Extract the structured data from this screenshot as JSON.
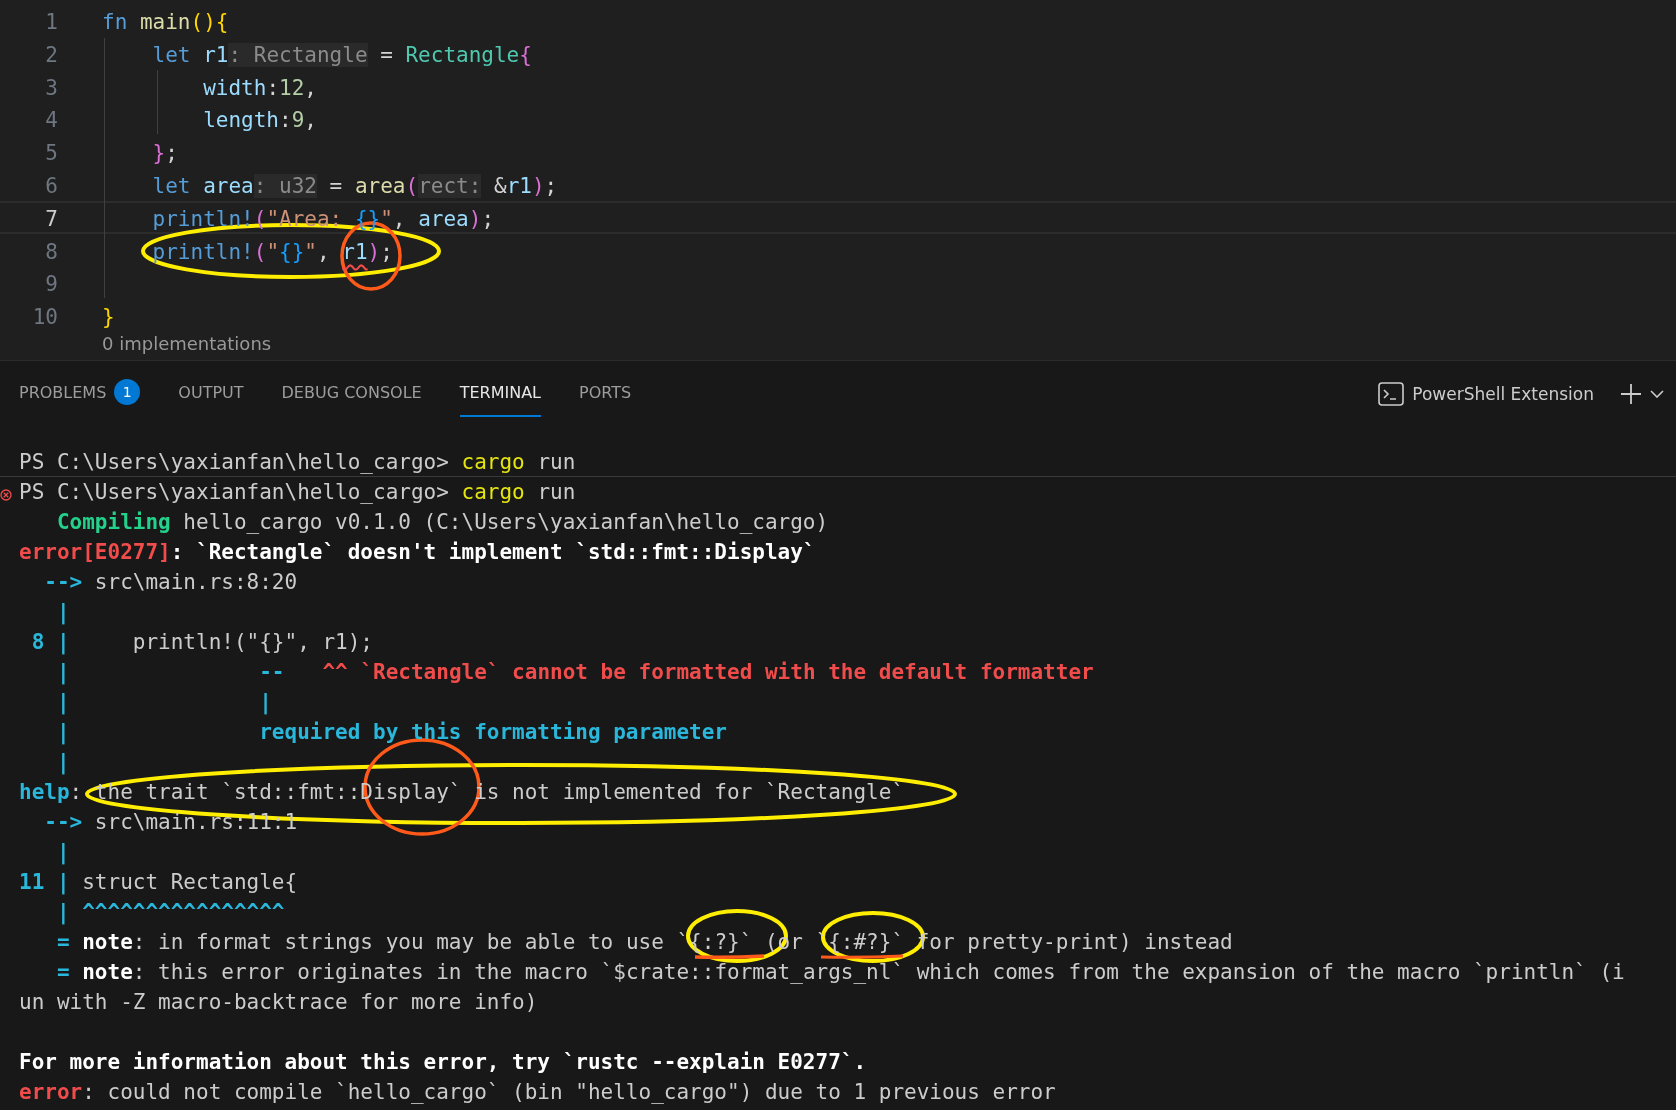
{
  "editor": {
    "lines": [
      {
        "number": "1",
        "current": false,
        "tokens": [
          {
            "text": "fn ",
            "kind": "kw"
          },
          {
            "text": "main",
            "kind": "fn"
          },
          {
            "text": "()",
            "kind": "brace1"
          },
          {
            "text": "{",
            "kind": "brace1"
          }
        ]
      },
      {
        "number": "2",
        "current": false,
        "tokens": [
          {
            "text": "    let ",
            "kind": "kw"
          },
          {
            "text": "r1",
            "kind": "var"
          },
          {
            "text": ": Rectangle",
            "kind": "hint"
          },
          {
            "text": " = ",
            "kind": "plain"
          },
          {
            "text": "Rectangle",
            "kind": "type"
          },
          {
            "text": "{",
            "kind": "brace2"
          }
        ]
      },
      {
        "number": "3",
        "current": false,
        "tokens": [
          {
            "text": "        width",
            "kind": "var"
          },
          {
            "text": ":",
            "kind": "plain"
          },
          {
            "text": "12",
            "kind": "num"
          },
          {
            "text": ",",
            "kind": "plain"
          }
        ]
      },
      {
        "number": "4",
        "current": false,
        "tokens": [
          {
            "text": "        length",
            "kind": "var"
          },
          {
            "text": ":",
            "kind": "plain"
          },
          {
            "text": "9",
            "kind": "num"
          },
          {
            "text": ",",
            "kind": "plain"
          }
        ]
      },
      {
        "number": "5",
        "current": false,
        "tokens": [
          {
            "text": "    }",
            "kind": "brace2"
          },
          {
            "text": ";",
            "kind": "plain"
          }
        ]
      },
      {
        "number": "6",
        "current": false,
        "tokens": [
          {
            "text": "    let ",
            "kind": "kw"
          },
          {
            "text": "area",
            "kind": "var"
          },
          {
            "text": ": u32",
            "kind": "hint"
          },
          {
            "text": " = ",
            "kind": "plain"
          },
          {
            "text": "area",
            "kind": "fn"
          },
          {
            "text": "(",
            "kind": "brace2"
          },
          {
            "text": "rect:",
            "kind": "hint"
          },
          {
            "text": " &",
            "kind": "plain"
          },
          {
            "text": "r1",
            "kind": "var"
          },
          {
            "text": ")",
            "kind": "brace2"
          },
          {
            "text": ";",
            "kind": "plain"
          }
        ]
      },
      {
        "number": "7",
        "current": true,
        "tokens": [
          {
            "text": "    println!",
            "kind": "kw"
          },
          {
            "text": "(",
            "kind": "brace2"
          },
          {
            "text": "\"Area: ",
            "kind": "str"
          },
          {
            "text": "{}",
            "kind": "brace3"
          },
          {
            "text": "\"",
            "kind": "str"
          },
          {
            "text": ", ",
            "kind": "plain"
          },
          {
            "text": "area",
            "kind": "var"
          },
          {
            "text": ")",
            "kind": "brace2"
          },
          {
            "text": ";",
            "kind": "plain"
          }
        ]
      },
      {
        "number": "8",
        "current": false,
        "tokens": [
          {
            "text": "    println!",
            "kind": "kw"
          },
          {
            "text": "(",
            "kind": "brace2"
          },
          {
            "text": "\"",
            "kind": "str"
          },
          {
            "text": "{}",
            "kind": "brace3"
          },
          {
            "text": "\"",
            "kind": "str"
          },
          {
            "text": ", ",
            "kind": "plain"
          },
          {
            "text": "r1",
            "kind": "error"
          },
          {
            "text": ")",
            "kind": "brace2"
          },
          {
            "text": ";",
            "kind": "plain"
          }
        ]
      },
      {
        "number": "9",
        "current": false
      },
      {
        "number": "10",
        "current": false,
        "tokens": [
          {
            "text": "}",
            "kind": "brace1"
          }
        ]
      }
    ],
    "codelens": "0 implementations"
  },
  "panel": {
    "tabs": [
      {
        "label": "PROBLEMS",
        "badge": "1",
        "selected": false
      },
      {
        "label": "OUTPUT",
        "selected": false
      },
      {
        "label": "DEBUG CONSOLE",
        "selected": false
      },
      {
        "label": "TERMINAL",
        "selected": true
      },
      {
        "label": "PORTS",
        "selected": false
      }
    ],
    "terminal_name": "PowerShell Extension"
  },
  "terminal": {
    "blocks": [
      [
        {
          "failed": false,
          "segments": [
            {
              "text": "PS C:\\Users\\yaxianfan\\hello_cargo> ",
              "kind": "plain"
            },
            {
              "text": "cargo",
              "kind": "yellow"
            },
            {
              "text": " run",
              "kind": "plain"
            }
          ]
        },
        {
          "failed": true,
          "segments": [
            {
              "text": "PS C:\\Users\\yaxianfan\\hello_cargo> ",
              "kind": "plain"
            },
            {
              "text": "cargo",
              "kind": "yellow"
            },
            {
              "text": " run",
              "kind": "plain"
            }
          ]
        },
        {
          "failed": false,
          "segments": [
            {
              "text": "   Compiling",
              "kind": "green"
            },
            {
              "text": " hello_cargo v0.1.0 (C:\\Users\\yaxianfan\\hello_cargo)",
              "kind": "plain"
            }
          ]
        },
        {
          "failed": false,
          "segments": [
            {
              "text": "error[E0277]",
              "kind": "red"
            },
            {
              "text": ": `Rectangle` doesn't implement `std::fmt::Display`",
              "kind": "bold"
            }
          ]
        },
        {
          "failed": false,
          "segments": [
            {
              "text": "  -->",
              "kind": "blue"
            },
            {
              "text": " src\\main.rs:8:20",
              "kind": "plain"
            }
          ]
        },
        {
          "failed": false,
          "segments": [
            {
              "text": "   |",
              "kind": "blue"
            }
          ]
        },
        {
          "failed": false,
          "segments": [
            {
              "text": " 8 |",
              "kind": "blue"
            },
            {
              "text": "     println!(\"{}\", r1);",
              "kind": "plain"
            }
          ]
        },
        {
          "failed": false,
          "segments": [
            {
              "text": "   |               --",
              "kind": "blue"
            },
            {
              "text": "   ^^ `Rectangle` cannot be formatted with the default formatter",
              "kind": "red"
            }
          ]
        },
        {
          "failed": false,
          "segments": [
            {
              "text": "   |               |",
              "kind": "blue"
            }
          ]
        },
        {
          "failed": false,
          "segments": [
            {
              "text": "   |               required by this formatting parameter",
              "kind": "blue"
            }
          ]
        },
        {
          "failed": false,
          "segments": [
            {
              "text": "   |",
              "kind": "blue"
            }
          ]
        },
        {
          "failed": false,
          "segments": [
            {
              "text": "help",
              "kind": "blue"
            },
            {
              "text": ": the trait `std::fmt::Display` is not implemented for `Rectangle`",
              "kind": "plain"
            }
          ]
        },
        {
          "failed": false,
          "segments": [
            {
              "text": "  -->",
              "kind": "blue"
            },
            {
              "text": " src\\main.rs:11:1",
              "kind": "plain"
            }
          ]
        },
        {
          "failed": false,
          "segments": [
            {
              "text": "   |",
              "kind": "blue"
            }
          ]
        },
        {
          "failed": false,
          "segments": [
            {
              "text": "11 |",
              "kind": "blue"
            },
            {
              "text": " struct Rectangle{",
              "kind": "plain"
            }
          ]
        },
        {
          "failed": false,
          "segments": [
            {
              "text": "   | ^^^^^^^^^^^^^^^^",
              "kind": "blue"
            }
          ]
        },
        {
          "failed": false,
          "segments": [
            {
              "text": "   =",
              "kind": "blue"
            },
            {
              "text": " note",
              "kind": "bold"
            },
            {
              "text": ": in format strings you may be able to use ",
              "kind": "plain"
            },
            {
              "text": "`{:?}`",
              "kind": "plain"
            },
            {
              "text": " (or ",
              "kind": "plain"
            },
            {
              "text": "`{:#?}`",
              "kind": "plain"
            },
            {
              "text": " for pretty-print) instead",
              "kind": "plain"
            }
          ]
        },
        {
          "failed": false,
          "segments": [
            {
              "text": "   =",
              "kind": "blue"
            },
            {
              "text": " note",
              "kind": "bold"
            },
            {
              "text": ": this error originates in the macro ",
              "kind": "plain"
            },
            {
              "text": "`$crate::format_args_nl`",
              "kind": "plain"
            },
            {
              "text": " which comes from the expansion of the macro `println` (i",
              "kind": "plain"
            }
          ]
        },
        {
          "failed": false,
          "segments": [
            {
              "text": "un with -Z macro-backtrace for more info)",
              "kind": "plain"
            }
          ]
        }
      ],
      [
        {
          "failed": false,
          "segments": [
            {
              "text": "For more information about this error, try `rustc --explain E0277`.",
              "kind": "bold"
            }
          ]
        },
        {
          "failed": false,
          "segments": [
            {
              "text": "error",
              "kind": "red"
            },
            {
              "text": ": could not compile `hello_cargo` (bin \"hello_cargo\") due to 1 previous error",
              "kind": "plain"
            }
          ]
        }
      ]
    ]
  }
}
